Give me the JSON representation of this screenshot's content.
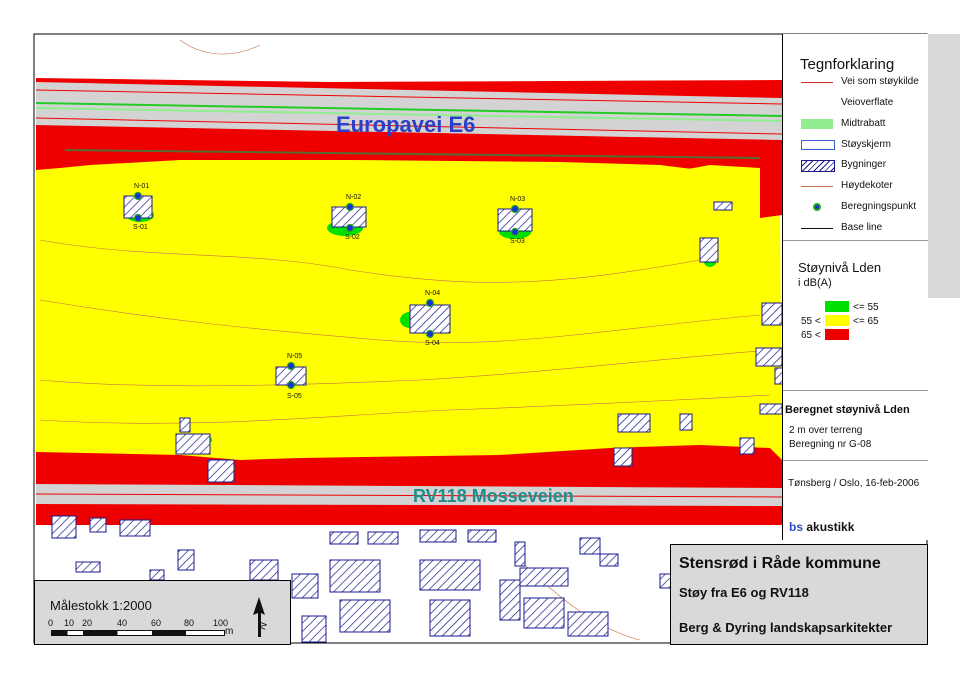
{
  "map": {
    "road_e6_label": "Europavei E6",
    "road_rv_label": "RV118 Mosseveien",
    "points": [
      {
        "north": "N-01",
        "south": "S-01"
      },
      {
        "north": "N-02",
        "south": "S-02"
      },
      {
        "north": "N-03",
        "south": "S-03"
      },
      {
        "north": "N-04",
        "south": "S-04"
      },
      {
        "north": "N-05",
        "south": "S-05"
      }
    ]
  },
  "legend": {
    "title": "Tegnforklaring",
    "items": [
      {
        "label": "Vei som støykilde",
        "icon": "red-line"
      },
      {
        "label": "Veioverflate",
        "icon": "plain"
      },
      {
        "label": "Midtrabatt",
        "icon": "green-bar"
      },
      {
        "label": "Støyskjerm",
        "icon": "blue-outline"
      },
      {
        "label": "Bygninger",
        "icon": "hatched-box"
      },
      {
        "label": "Høydekoter",
        "icon": "orange-line"
      },
      {
        "label": "Beregningspunkt",
        "icon": "blue-dot"
      },
      {
        "label": "Base line",
        "icon": "black-line"
      }
    ],
    "noise_title": "Støynivå Lden",
    "noise_unit": "i dB(A)",
    "classes": [
      {
        "prefix": "",
        "suffix": "<= 55",
        "color": "#00e000"
      },
      {
        "prefix": "55 <",
        "suffix": "<= 65",
        "color": "#ffff00"
      },
      {
        "prefix": "65 <",
        "suffix": "",
        "color": "#ee0000"
      }
    ],
    "calc_title": "Beregnet støynivå Lden",
    "calc_line1": "2 m over terreng",
    "calc_line2": "Beregning nr G-08",
    "place_date": "Tønsberg / Oslo, 16-feb-2006",
    "firm_bs": "bs",
    "firm_rest": " akustikk"
  },
  "titlebox": {
    "title": "Stensrød i Råde kommune",
    "subtitle": "Støy fra E6 og RV118",
    "firm": "Berg & Dyring landskapsarkitekter"
  },
  "scale": {
    "title": "Målestokk 1:2000",
    "ticks": [
      "0",
      "10",
      "20",
      "40",
      "60",
      "80",
      "100"
    ],
    "unit": "m"
  },
  "colors": {
    "red": "#ee0000",
    "yellow": "#ffff00",
    "green": "#00e000",
    "grey": "#d9d9d9"
  }
}
